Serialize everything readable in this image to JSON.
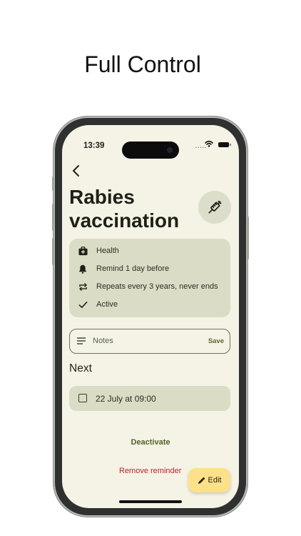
{
  "headline": "Full Control",
  "status_bar": {
    "time": "13:39",
    "signal": "....."
  },
  "reminder": {
    "title": "Rabies vaccination",
    "info": [
      {
        "icon": "medical-kit-icon",
        "text": "Health"
      },
      {
        "icon": "bell-icon",
        "text": "Remind 1 day before"
      },
      {
        "icon": "repeat-icon",
        "text": "Repeats every 3 years, never ends"
      },
      {
        "icon": "check-icon",
        "text": "Active"
      }
    ]
  },
  "notes": {
    "placeholder": "Notes",
    "save_label": "Save"
  },
  "next": {
    "heading": "Next",
    "occurrences": [
      {
        "label": "22 July at 09:00",
        "checked": false
      }
    ]
  },
  "actions": {
    "deactivate": "Deactivate",
    "remove": "Remove reminder",
    "edit": "Edit"
  },
  "colors": {
    "background": "#f4f3e6",
    "card": "#dbdcc5",
    "accent_text": "#55602a",
    "danger_text": "#b3262e",
    "fab": "#fde18a"
  }
}
